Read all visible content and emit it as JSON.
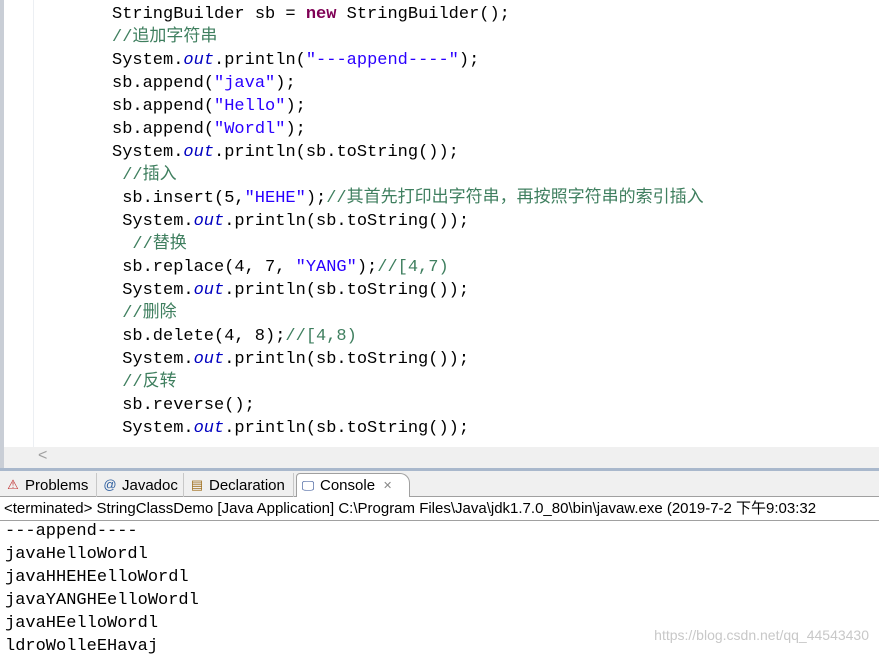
{
  "editor": {
    "lines": [
      {
        "indent": 11,
        "tokens": [
          [
            "StringBuilder sb = ",
            ""
          ],
          [
            "new",
            "kw"
          ],
          [
            " StringBuilder();",
            ""
          ]
        ]
      },
      {
        "indent": 11,
        "tokens": [
          [
            "//追加字符串",
            "cm"
          ]
        ]
      },
      {
        "indent": 11,
        "tokens": [
          [
            "System.",
            ""
          ],
          [
            "out",
            "fld"
          ],
          [
            ".println(",
            ""
          ],
          [
            "\"---append----\"",
            "str"
          ],
          [
            ");",
            ""
          ]
        ]
      },
      {
        "indent": 11,
        "tokens": [
          [
            "sb.append(",
            ""
          ],
          [
            "\"java\"",
            "str"
          ],
          [
            ");",
            ""
          ]
        ]
      },
      {
        "indent": 11,
        "tokens": [
          [
            "sb.append(",
            ""
          ],
          [
            "\"Hello\"",
            "str"
          ],
          [
            ");",
            ""
          ]
        ]
      },
      {
        "indent": 11,
        "tokens": [
          [
            "sb.append(",
            ""
          ],
          [
            "\"Wordl\"",
            "str"
          ],
          [
            ");",
            ""
          ]
        ]
      },
      {
        "indent": 11,
        "tokens": [
          [
            "System.",
            ""
          ],
          [
            "out",
            "fld"
          ],
          [
            ".println(sb.toString());",
            ""
          ]
        ]
      },
      {
        "indent": 12,
        "tokens": [
          [
            "//插入",
            "cm"
          ]
        ]
      },
      {
        "indent": 12,
        "tokens": [
          [
            "sb.insert(5,",
            ""
          ],
          [
            "\"HEHE\"",
            "str"
          ],
          [
            ");",
            ""
          ],
          [
            "//其首先打印出字符串，再按照字符串的索引插入",
            "cm"
          ]
        ]
      },
      {
        "indent": 12,
        "tokens": [
          [
            "System.",
            ""
          ],
          [
            "out",
            "fld"
          ],
          [
            ".println(sb.toString());",
            ""
          ]
        ]
      },
      {
        "indent": 13,
        "tokens": [
          [
            "//替换",
            "cm"
          ]
        ]
      },
      {
        "indent": 12,
        "tokens": [
          [
            "sb.replace(4, 7, ",
            ""
          ],
          [
            "\"YANG\"",
            "str"
          ],
          [
            ");",
            ""
          ],
          [
            "//[4,7)",
            "cm"
          ]
        ]
      },
      {
        "indent": 12,
        "tokens": [
          [
            "System.",
            ""
          ],
          [
            "out",
            "fld"
          ],
          [
            ".println(sb.toString());",
            ""
          ]
        ]
      },
      {
        "indent": 12,
        "tokens": [
          [
            "//删除",
            "cm"
          ]
        ]
      },
      {
        "indent": 12,
        "tokens": [
          [
            "sb.delete(4, 8);",
            ""
          ],
          [
            "//[4,8)",
            "cm"
          ]
        ]
      },
      {
        "indent": 12,
        "tokens": [
          [
            "System.",
            ""
          ],
          [
            "out",
            "fld"
          ],
          [
            ".println(sb.toString());",
            ""
          ]
        ]
      },
      {
        "indent": 12,
        "tokens": [
          [
            "//反转",
            "cm"
          ]
        ]
      },
      {
        "indent": 12,
        "tokens": [
          [
            "sb.reverse();",
            ""
          ]
        ]
      },
      {
        "indent": 12,
        "tokens": [
          [
            "System.",
            ""
          ],
          [
            "out",
            "fld"
          ],
          [
            ".println(sb.toString());",
            ""
          ]
        ]
      }
    ]
  },
  "tabs": [
    {
      "label": "Problems",
      "icon": "problems-icon",
      "glyph": "⚠"
    },
    {
      "label": "Javadoc",
      "icon": "at-icon",
      "glyph": "@"
    },
    {
      "label": "Declaration",
      "icon": "declaration-icon",
      "glyph": "▤"
    },
    {
      "label": "Console",
      "icon": "console-icon",
      "glyph": "🖵",
      "active": true,
      "close": "✕"
    }
  ],
  "console": {
    "header": "<terminated> StringClassDemo [Java Application] C:\\Program Files\\Java\\jdk1.7.0_80\\bin\\javaw.exe (2019-7-2 下午9:03:32",
    "output": [
      "---append----",
      "javaHelloWordl",
      "javaHHEHEelloWordl",
      "javaYANGHEelloWordl",
      "javaHEelloWordl",
      "ldroWolleEHavaj"
    ]
  },
  "watermark": "https://blog.csdn.net/qq_44543430"
}
